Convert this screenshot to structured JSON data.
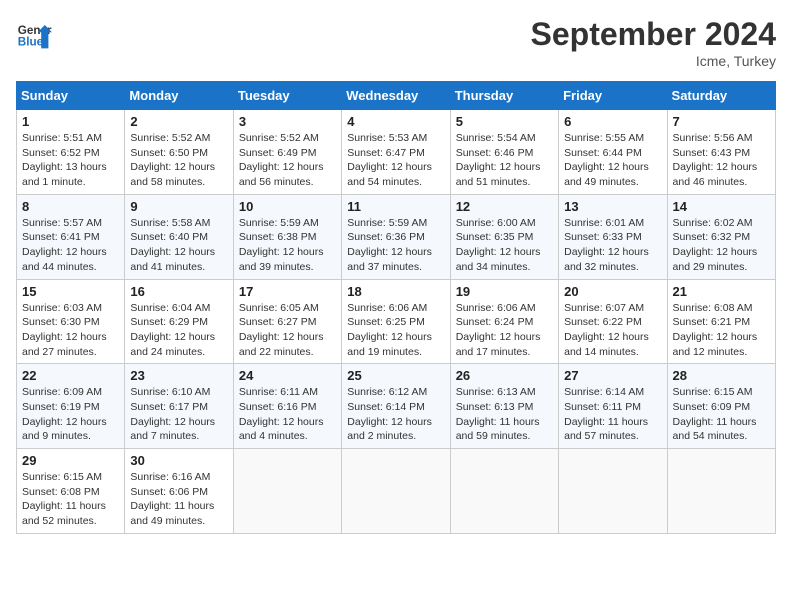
{
  "header": {
    "logo_line1": "General",
    "logo_line2": "Blue",
    "month_title": "September 2024",
    "location": "Icme, Turkey"
  },
  "weekdays": [
    "Sunday",
    "Monday",
    "Tuesday",
    "Wednesday",
    "Thursday",
    "Friday",
    "Saturday"
  ],
  "weeks": [
    [
      {
        "day": "1",
        "info": "Sunrise: 5:51 AM\nSunset: 6:52 PM\nDaylight: 13 hours\nand 1 minute."
      },
      {
        "day": "2",
        "info": "Sunrise: 5:52 AM\nSunset: 6:50 PM\nDaylight: 12 hours\nand 58 minutes."
      },
      {
        "day": "3",
        "info": "Sunrise: 5:52 AM\nSunset: 6:49 PM\nDaylight: 12 hours\nand 56 minutes."
      },
      {
        "day": "4",
        "info": "Sunrise: 5:53 AM\nSunset: 6:47 PM\nDaylight: 12 hours\nand 54 minutes."
      },
      {
        "day": "5",
        "info": "Sunrise: 5:54 AM\nSunset: 6:46 PM\nDaylight: 12 hours\nand 51 minutes."
      },
      {
        "day": "6",
        "info": "Sunrise: 5:55 AM\nSunset: 6:44 PM\nDaylight: 12 hours\nand 49 minutes."
      },
      {
        "day": "7",
        "info": "Sunrise: 5:56 AM\nSunset: 6:43 PM\nDaylight: 12 hours\nand 46 minutes."
      }
    ],
    [
      {
        "day": "8",
        "info": "Sunrise: 5:57 AM\nSunset: 6:41 PM\nDaylight: 12 hours\nand 44 minutes."
      },
      {
        "day": "9",
        "info": "Sunrise: 5:58 AM\nSunset: 6:40 PM\nDaylight: 12 hours\nand 41 minutes."
      },
      {
        "day": "10",
        "info": "Sunrise: 5:59 AM\nSunset: 6:38 PM\nDaylight: 12 hours\nand 39 minutes."
      },
      {
        "day": "11",
        "info": "Sunrise: 5:59 AM\nSunset: 6:36 PM\nDaylight: 12 hours\nand 37 minutes."
      },
      {
        "day": "12",
        "info": "Sunrise: 6:00 AM\nSunset: 6:35 PM\nDaylight: 12 hours\nand 34 minutes."
      },
      {
        "day": "13",
        "info": "Sunrise: 6:01 AM\nSunset: 6:33 PM\nDaylight: 12 hours\nand 32 minutes."
      },
      {
        "day": "14",
        "info": "Sunrise: 6:02 AM\nSunset: 6:32 PM\nDaylight: 12 hours\nand 29 minutes."
      }
    ],
    [
      {
        "day": "15",
        "info": "Sunrise: 6:03 AM\nSunset: 6:30 PM\nDaylight: 12 hours\nand 27 minutes."
      },
      {
        "day": "16",
        "info": "Sunrise: 6:04 AM\nSunset: 6:29 PM\nDaylight: 12 hours\nand 24 minutes."
      },
      {
        "day": "17",
        "info": "Sunrise: 6:05 AM\nSunset: 6:27 PM\nDaylight: 12 hours\nand 22 minutes."
      },
      {
        "day": "18",
        "info": "Sunrise: 6:06 AM\nSunset: 6:25 PM\nDaylight: 12 hours\nand 19 minutes."
      },
      {
        "day": "19",
        "info": "Sunrise: 6:06 AM\nSunset: 6:24 PM\nDaylight: 12 hours\nand 17 minutes."
      },
      {
        "day": "20",
        "info": "Sunrise: 6:07 AM\nSunset: 6:22 PM\nDaylight: 12 hours\nand 14 minutes."
      },
      {
        "day": "21",
        "info": "Sunrise: 6:08 AM\nSunset: 6:21 PM\nDaylight: 12 hours\nand 12 minutes."
      }
    ],
    [
      {
        "day": "22",
        "info": "Sunrise: 6:09 AM\nSunset: 6:19 PM\nDaylight: 12 hours\nand 9 minutes."
      },
      {
        "day": "23",
        "info": "Sunrise: 6:10 AM\nSunset: 6:17 PM\nDaylight: 12 hours\nand 7 minutes."
      },
      {
        "day": "24",
        "info": "Sunrise: 6:11 AM\nSunset: 6:16 PM\nDaylight: 12 hours\nand 4 minutes."
      },
      {
        "day": "25",
        "info": "Sunrise: 6:12 AM\nSunset: 6:14 PM\nDaylight: 12 hours\nand 2 minutes."
      },
      {
        "day": "26",
        "info": "Sunrise: 6:13 AM\nSunset: 6:13 PM\nDaylight: 11 hours\nand 59 minutes."
      },
      {
        "day": "27",
        "info": "Sunrise: 6:14 AM\nSunset: 6:11 PM\nDaylight: 11 hours\nand 57 minutes."
      },
      {
        "day": "28",
        "info": "Sunrise: 6:15 AM\nSunset: 6:09 PM\nDaylight: 11 hours\nand 54 minutes."
      }
    ],
    [
      {
        "day": "29",
        "info": "Sunrise: 6:15 AM\nSunset: 6:08 PM\nDaylight: 11 hours\nand 52 minutes."
      },
      {
        "day": "30",
        "info": "Sunrise: 6:16 AM\nSunset: 6:06 PM\nDaylight: 11 hours\nand 49 minutes."
      },
      {
        "day": "",
        "info": ""
      },
      {
        "day": "",
        "info": ""
      },
      {
        "day": "",
        "info": ""
      },
      {
        "day": "",
        "info": ""
      },
      {
        "day": "",
        "info": ""
      }
    ]
  ]
}
